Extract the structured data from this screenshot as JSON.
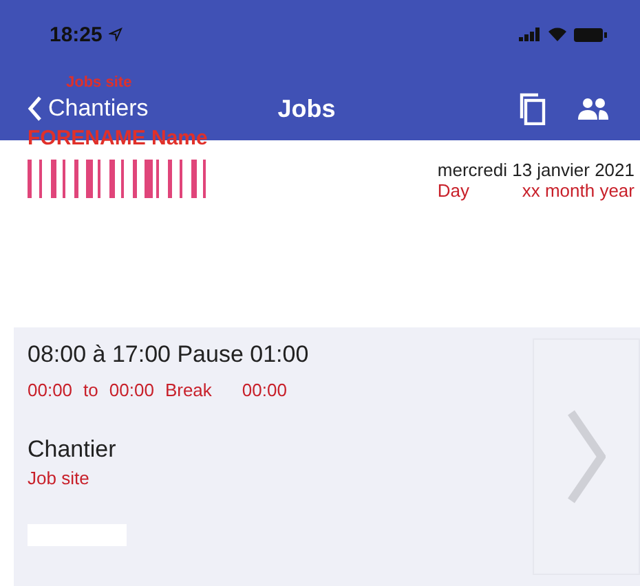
{
  "status_bar": {
    "time": "18:25"
  },
  "nav_bar": {
    "back_label": "Chantiers",
    "back_note": "Jobs site",
    "title": "Jobs"
  },
  "header": {
    "name_note": "FORENAME Name",
    "date": "mercredi 13 janvier 2021",
    "date_note_day": "Day",
    "date_note_rest": "xx month year"
  },
  "job": {
    "hours": "08:00 à 17:00 Pause 01:00",
    "hours_note": [
      "00:00",
      "to",
      "00:00",
      "Break",
      "00:00"
    ],
    "site_label": "Chantier",
    "site_note": "Job site"
  }
}
